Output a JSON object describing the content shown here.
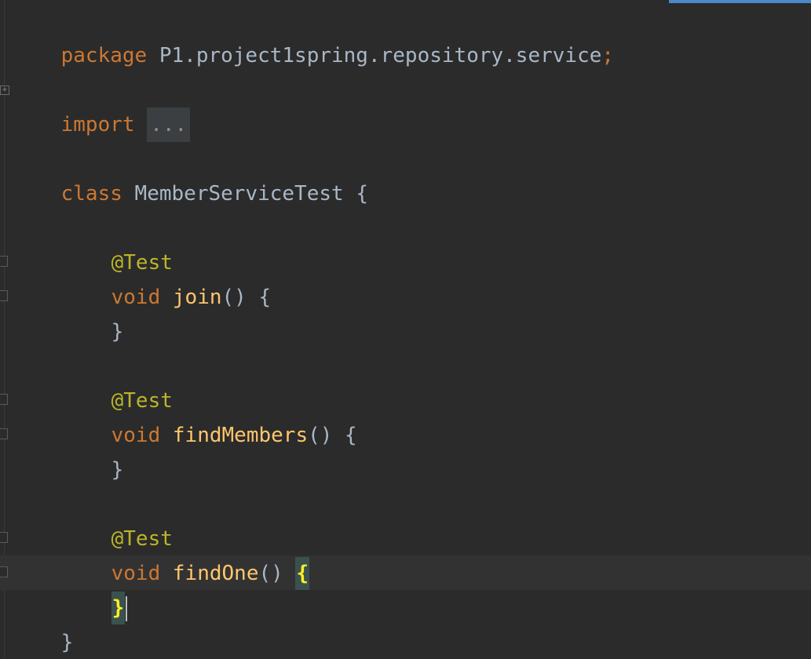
{
  "editor": {
    "lines": {
      "package_kw": "package",
      "package_name": " P1.project1spring.repository.service",
      "package_semicolon": ";",
      "import_kw": "import",
      "import_folded": "...",
      "class_kw": "class",
      "class_name": " MemberServiceTest {",
      "annotation_1": "@Test",
      "void_1": "void",
      "method_1": "join",
      "method_1_rest": "() {",
      "close_1": "}",
      "annotation_2": "@Test",
      "void_2": "void",
      "method_2": "findMembers",
      "method_2_rest": "() {",
      "close_2": "}",
      "annotation_3": "@Test",
      "void_3": "void",
      "method_3": "findOne",
      "method_3_rest": "() ",
      "open_brace_3": "{",
      "close_3": "}",
      "class_close": "}"
    },
    "colors": {
      "background": "#2b2b2b",
      "keyword": "#cc7832",
      "annotation": "#bbb529",
      "method": "#ffc66d",
      "text": "#a9b7c6",
      "brace_highlight": "#ffef28",
      "accent": "#4a88c7"
    },
    "icons": [
      "fold-plus-icon",
      "fold-marker-icon",
      "caret"
    ]
  }
}
